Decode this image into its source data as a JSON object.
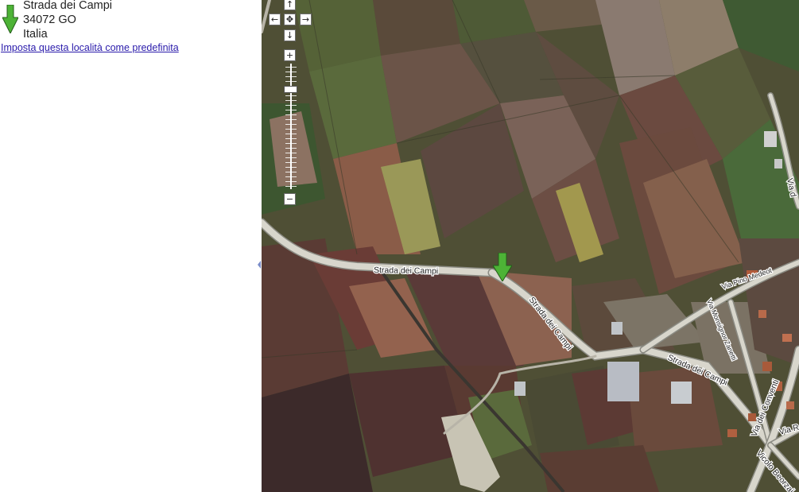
{
  "address": {
    "street": "Strada dei Campi",
    "postal_line": "34072 GO",
    "country": "Italia"
  },
  "set_default_link": "Imposta questa località come predefinita",
  "map": {
    "road_labels": {
      "strada_dei_campi_1": "Strada dei Campi",
      "strada_dei_campi_2": "Strada dei Campi",
      "strada_dei_campi_3": "Strada dei Campi",
      "via_pino_medeot": "Via Pino Medeot",
      "via_monsignor_zanetti": "Via Monsignor Zanetti",
      "via_dei_conventi": "Via dei Conventi",
      "vicolo_beorzai": "Vicolo Beorzai",
      "via_d": "Via d",
      "via_r": "Via R"
    },
    "controls": {
      "pan_up": "↑",
      "pan_left": "←",
      "pan_center": "✥",
      "pan_right": "→",
      "pan_down": "↓",
      "zoom_in": "+",
      "zoom_out": "−"
    },
    "marker_color": "#4db336"
  }
}
